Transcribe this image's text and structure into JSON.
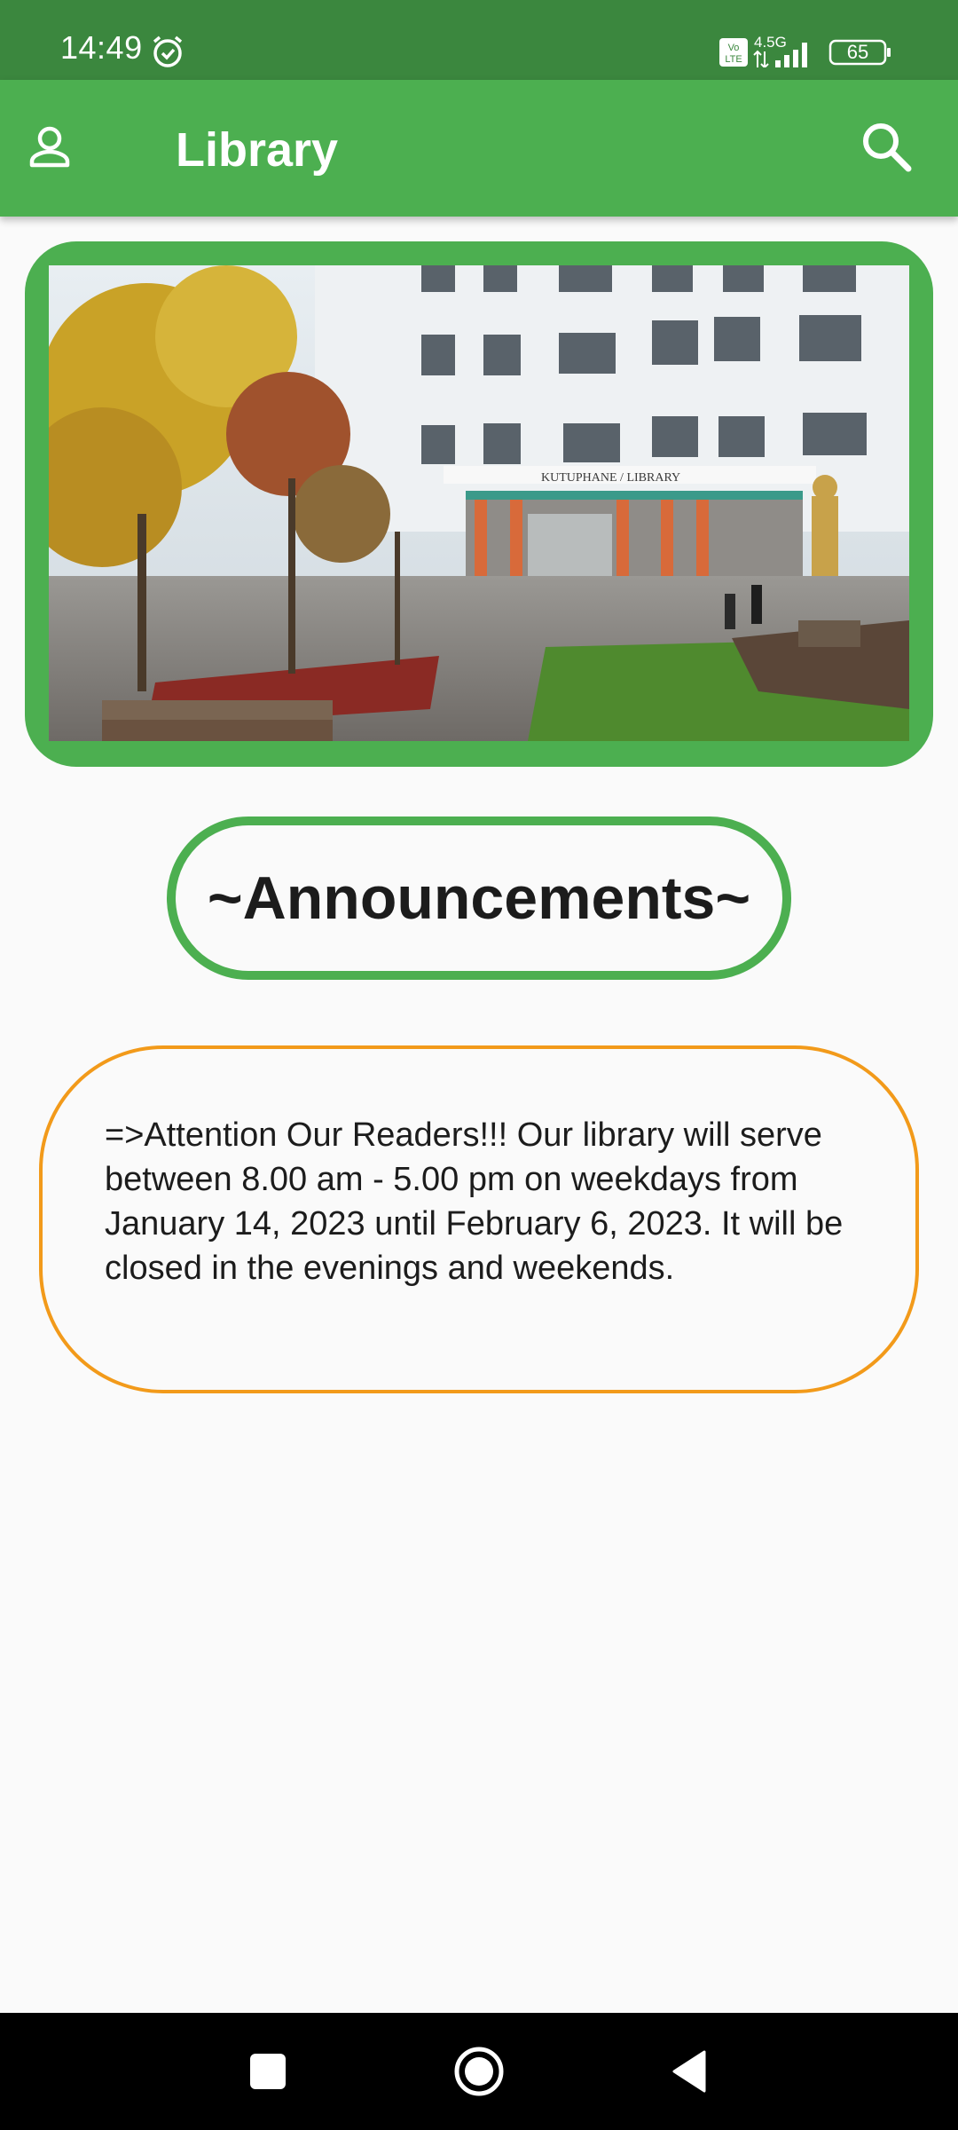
{
  "status_bar": {
    "time": "14:49",
    "network": "4.5G",
    "battery": "65",
    "icons": [
      "alarm-icon",
      "volte-icon",
      "signal-icon",
      "battery-icon"
    ]
  },
  "app_bar": {
    "title": "Library",
    "left_icon": "person-icon",
    "right_icon": "search-icon"
  },
  "banner": {
    "sign_text": "KUTUPHANE / LIBRARY"
  },
  "announcements": {
    "heading": "~Announcements~",
    "items": [
      "=>Attention Our Readers!!! Our library will serve between 8.00 am - 5.00 pm on weekdays from January 14, 2023 until February 6, 2023. It will be closed in the evenings and weekends."
    ]
  },
  "nav_bar": {
    "buttons": [
      "recents-icon",
      "home-icon",
      "back-icon"
    ]
  },
  "colors": {
    "status_bar": "#3b873e",
    "app_bar": "#4caf50",
    "accent_green": "#4caf50",
    "card_border": "#f29a1a",
    "background": "#fafafa"
  }
}
